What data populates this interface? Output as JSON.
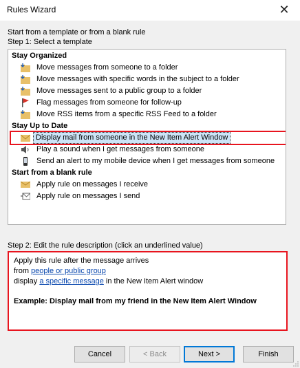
{
  "window": {
    "title": "Rules Wizard"
  },
  "intro": {
    "line1": "Start from a template or from a blank rule",
    "line2": "Step 1: Select a template"
  },
  "templates": {
    "groups": [
      {
        "label": "Stay Organized"
      },
      {
        "label": "Stay Up to Date"
      },
      {
        "label": "Start from a blank rule"
      }
    ],
    "items": [
      {
        "label": "Move messages from someone to a folder",
        "icon": "folder-move-icon"
      },
      {
        "label": "Move messages with specific words in the subject to a folder",
        "icon": "folder-move-icon"
      },
      {
        "label": "Move messages sent to a public group to a folder",
        "icon": "folder-move-icon"
      },
      {
        "label": "Flag messages from someone for follow-up",
        "icon": "flag-icon"
      },
      {
        "label": "Move RSS items from a specific RSS Feed to a folder",
        "icon": "folder-move-icon"
      },
      {
        "label": "Display mail from someone in the New Item Alert Window",
        "icon": "alert-window-icon"
      },
      {
        "label": "Play a sound when I get messages from someone",
        "icon": "speaker-icon"
      },
      {
        "label": "Send an alert to my mobile device when I get messages from someone",
        "icon": "mobile-phone-icon"
      },
      {
        "label": "Apply rule on messages I receive",
        "icon": "envelope-icon"
      },
      {
        "label": "Apply rule on messages I send",
        "icon": "send-envelope-icon"
      }
    ],
    "selected_index": 5
  },
  "step2": {
    "label": "Step 2: Edit the rule description (click an underlined value)",
    "line1": "Apply this rule after the message arrives",
    "line2_prefix": "from",
    "line2_link": "people or public group",
    "line3_prefix": "display",
    "line3_link": "a specific message",
    "line3_suffix": "in the New Item Alert window",
    "example": "Example: Display mail from my friend in the New Item Alert Window"
  },
  "buttons": {
    "cancel": "Cancel",
    "back": "< Back",
    "next": "Next >",
    "finish": "Finish"
  },
  "colors": {
    "highlight": "#e8141e",
    "selection": "#cce4f7",
    "link": "#0645ad",
    "accent": "#0078d7"
  }
}
